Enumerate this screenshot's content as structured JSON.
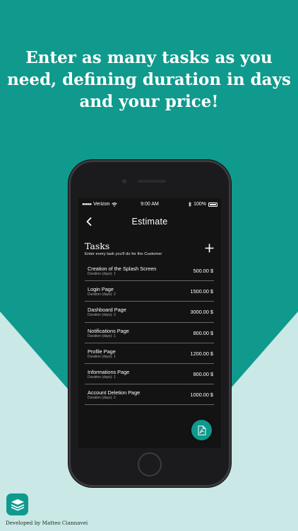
{
  "promo": {
    "headline_line1": "Enter as many tasks as you",
    "headline_line2": "need, defining duration in days",
    "headline_line3": "and your price!"
  },
  "status_bar": {
    "carrier": "Verizon",
    "time": "9:00 AM",
    "battery": "100%"
  },
  "navbar": {
    "title": "Estimate",
    "back_icon": "chevron-left-icon"
  },
  "tasks": {
    "title": "Tasks",
    "subtitle": "Enter every task you'll do for the Customer",
    "add_icon": "plus-icon",
    "items": [
      {
        "name": "Creation of the Splash Screen",
        "duration": "Duration (days): 1",
        "price": "500.00 $"
      },
      {
        "name": "Login Page",
        "duration": "Duration (days): 2",
        "price": "1500.00 $"
      },
      {
        "name": "Dashboard Page",
        "duration": "Duration (days): 3",
        "price": "3000.00 $"
      },
      {
        "name": "Notifications Page",
        "duration": "Duration (days): 1",
        "price": "800.00 $"
      },
      {
        "name": "Profile Page",
        "duration": "Duration (days): 1",
        "price": "1200.00 $"
      },
      {
        "name": "Informations Page",
        "duration": "Duration (days): 1",
        "price": "800.00 $"
      },
      {
        "name": "Account Deletion Page",
        "duration": "Duration (days): 2",
        "price": "1000.00 $"
      }
    ]
  },
  "fab": {
    "icon": "pdf-file-icon"
  },
  "footer": {
    "credit": "Developed by Matteo Ciannavei",
    "app_icon": "stacked-layers-icon"
  },
  "colors": {
    "brand_teal": "#0f9a8d",
    "light_teal": "#c9e8e6",
    "screen_bg": "#131313"
  }
}
